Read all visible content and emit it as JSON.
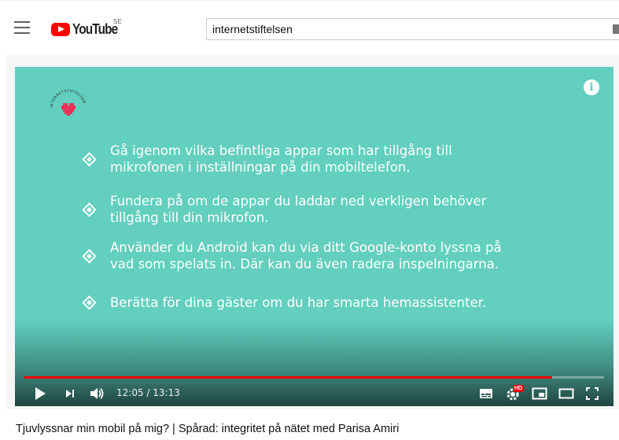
{
  "header": {
    "logo_text": "YouTube",
    "logo_country": "SE",
    "search_value": "internetstiftelsen"
  },
  "player": {
    "brand_text": "INTERNETSTIFTELSEN",
    "tips": [
      "Gå igenom vilka befintliga appar som har tillgång till mikrofonen i inställningar på din mobiltelefon.",
      "Fundera på om de appar du laddar ned verkligen behöver tillgång till din mikrofon.",
      "Använder du Android kan du via ditt Google-konto lyssna på vad som spelats in. Där kan du även radera inspelningarna.",
      "Berätta för dina gäster om du har smarta hemassistenter."
    ],
    "tip_lines": [
      [
        "Gå igenom vilka befintliga appar som har tillgång till",
        "mikrofonen i inställningar på din mobiltelefon."
      ],
      [
        "Fundera på om de appar du laddar ned verkligen behöver",
        "tillgång till din mikrofon."
      ],
      [
        "Använder du Android kan du via ditt Google-konto lyssna på",
        "vad som spelats in. Där kan du även radera inspelningarna."
      ],
      [
        "Berätta för dina gäster om du har smarta hemassistenter."
      ]
    ],
    "time_current": "12:05",
    "time_separator": " / ",
    "time_total": "13:13",
    "progress_fraction": 0.911,
    "quality_badge": "HD",
    "bg_color": "#62cfbf",
    "progress_color": "#ee0000"
  },
  "video": {
    "title": "Tjuvlyssnar min mobil på mig? | Spårad: integritet på nätet med Parisa Amiri"
  },
  "icons": [
    "menu-icon",
    "youtube-logo-icon",
    "info-icon",
    "play-icon",
    "next-icon",
    "volume-icon",
    "subtitles-icon",
    "settings-icon",
    "miniplayer-icon",
    "theater-icon",
    "fullscreen-icon",
    "heart-icon"
  ]
}
